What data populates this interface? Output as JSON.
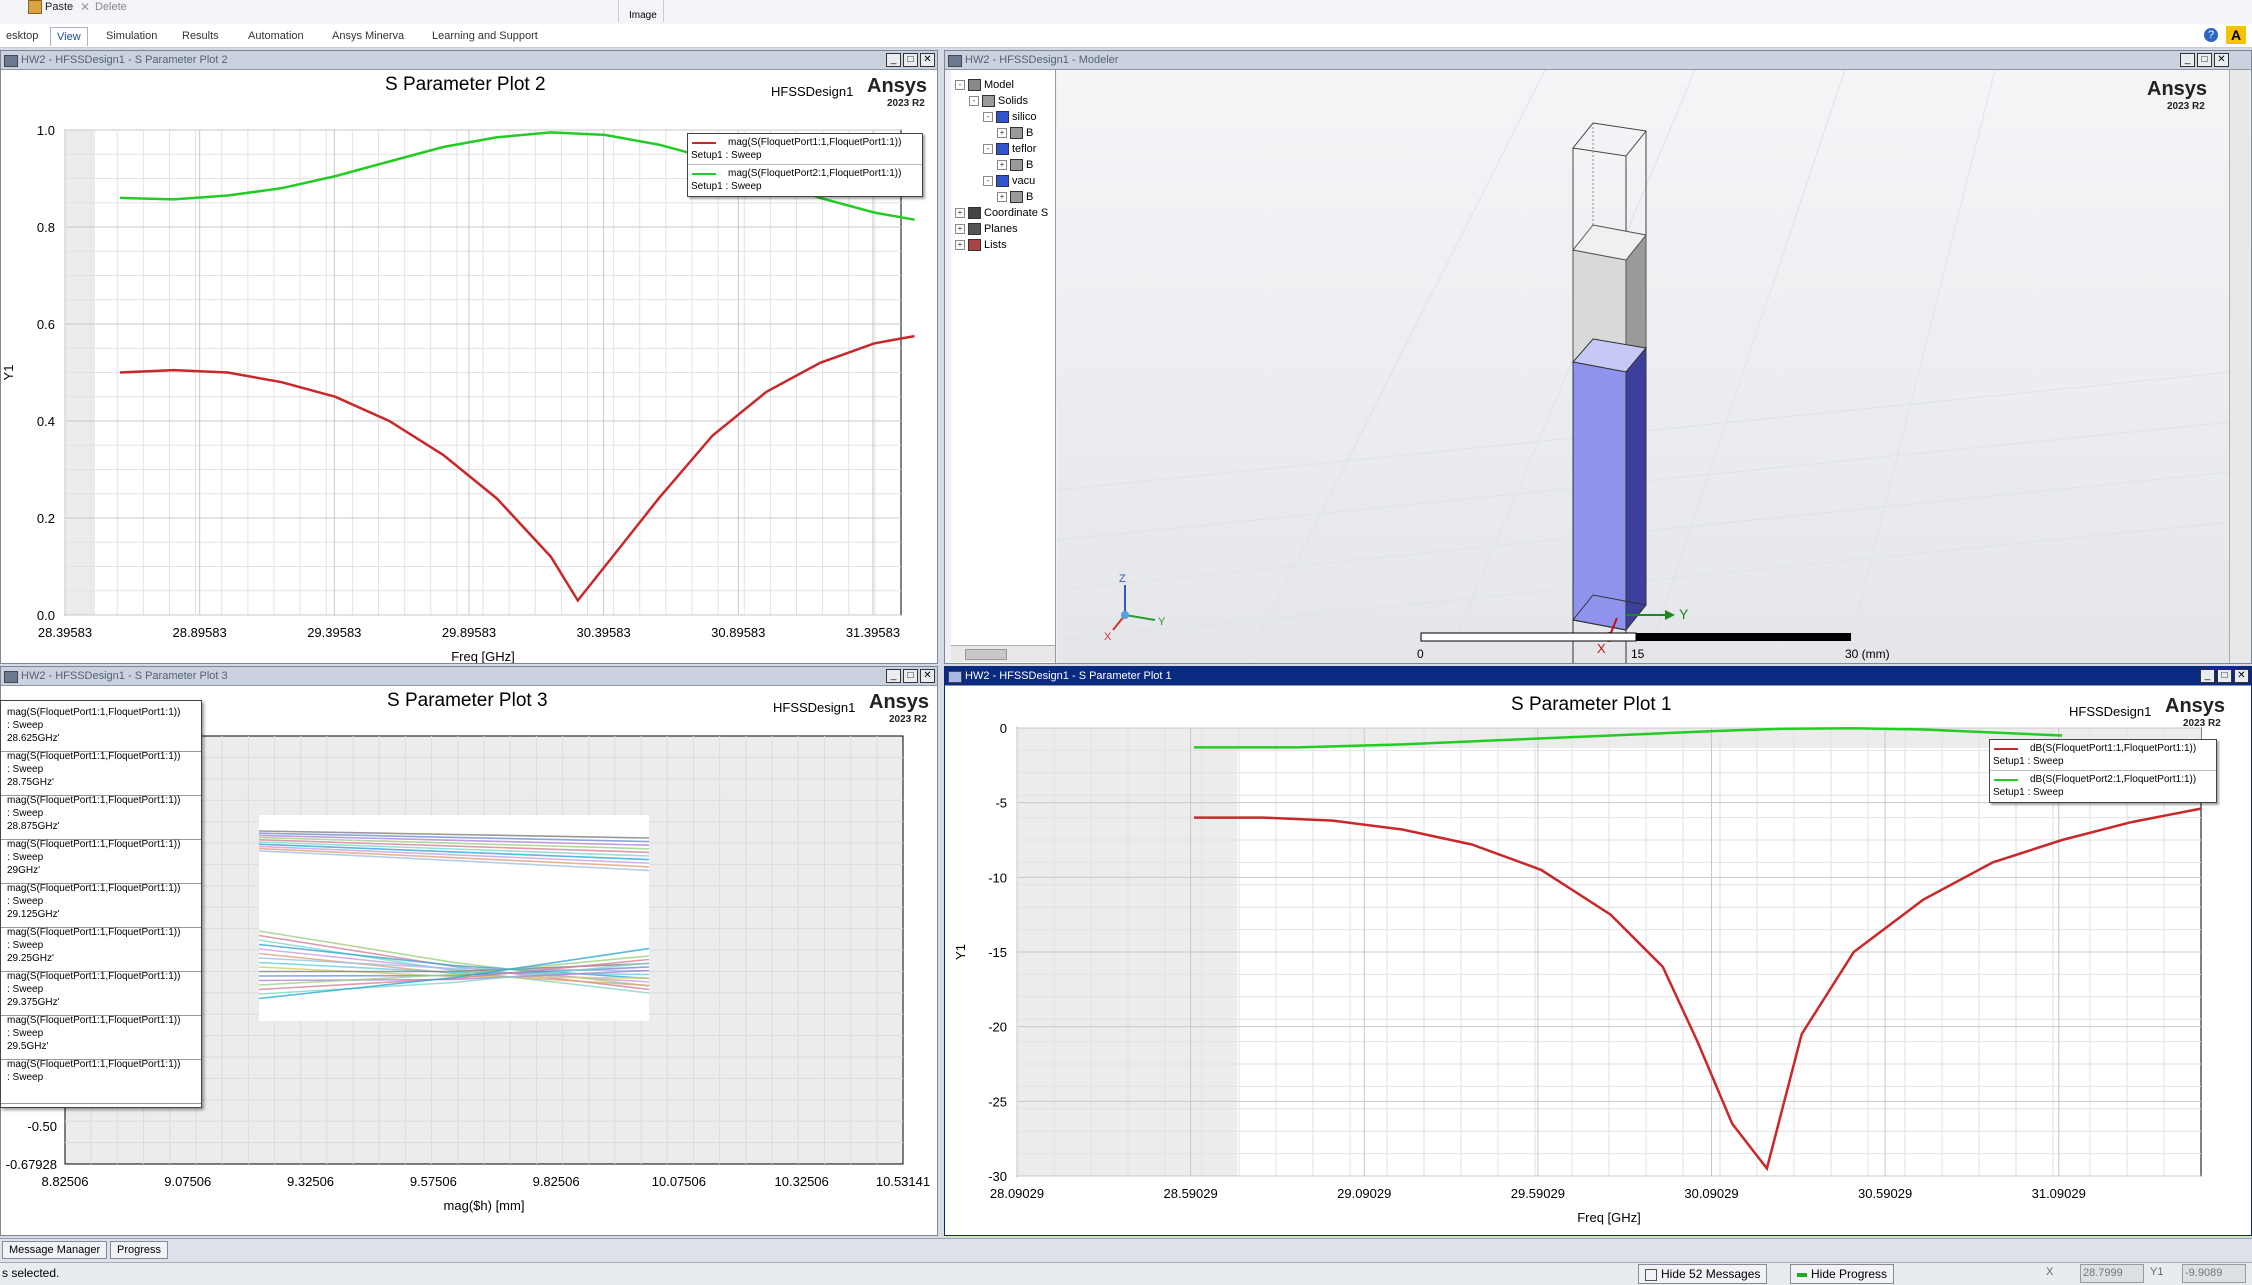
{
  "ribbon": {
    "paste_label": "Paste",
    "delete_label": "Delete",
    "capture_label": "Image",
    "tabs": [
      {
        "label": "esktop"
      },
      {
        "label": "View"
      },
      {
        "label": "Simulation"
      },
      {
        "label": "Results"
      },
      {
        "label": "Automation"
      },
      {
        "label": "Ansys Minerva"
      },
      {
        "label": "Learning and Support"
      }
    ],
    "active_tab": "View"
  },
  "windows": {
    "plot2": {
      "title": "HW2 - HFSSDesign1 - S Parameter Plot 2",
      "plot_title": "S Parameter Plot 2",
      "design": "HFSSDesign1",
      "brand": "Ansys",
      "version": "2023 R2",
      "legend": [
        {
          "name": "mag(S(FloquetPort1:1,FloquetPort1:1))",
          "setup": "Setup1 : Sweep",
          "color": "#c8282a"
        },
        {
          "name": "mag(S(FloquetPort2:1,FloquetPort1:1))",
          "setup": "Setup1 : Sweep",
          "color": "#22cc22"
        }
      ]
    },
    "modeler": {
      "title": "HW2 - HFSSDesign1 - Modeler",
      "brand": "Ansys",
      "version": "2023 R2",
      "scale_ticks": [
        "0",
        "15",
        "30 (mm)"
      ],
      "tree": [
        {
          "label": "Model",
          "level": 0,
          "box": "-"
        },
        {
          "label": "Solids",
          "level": 1,
          "box": "-"
        },
        {
          "label": "silico",
          "level": 2,
          "box": "-"
        },
        {
          "label": "B",
          "level": 3,
          "box": "+"
        },
        {
          "label": "teflor",
          "level": 2,
          "box": "-"
        },
        {
          "label": "B",
          "level": 3,
          "box": "+"
        },
        {
          "label": "vacu",
          "level": 2,
          "box": "-"
        },
        {
          "label": "B",
          "level": 3,
          "box": "+"
        },
        {
          "label": "Coordinate S",
          "level": 0,
          "box": "+"
        },
        {
          "label": "Planes",
          "level": 0,
          "box": "+"
        },
        {
          "label": "Lists",
          "level": 0,
          "box": "+"
        }
      ],
      "axis_labels": {
        "x": "X",
        "y": "Y",
        "z": "Z"
      }
    },
    "plot3": {
      "title": "HW2 - HFSSDesign1 - S Parameter Plot 3",
      "plot_title": "S Parameter Plot 3",
      "design": "HFSSDesign1",
      "brand": "Ansys",
      "version": "2023 R2",
      "legend": [
        {
          "name": "mag(S(FloquetPort1:1,FloquetPort1:1))",
          "setup": ": Sweep",
          "freq": "28.625GHz'"
        },
        {
          "name": "mag(S(FloquetPort1:1,FloquetPort1:1))",
          "setup": ": Sweep",
          "freq": "28.75GHz'"
        },
        {
          "name": "mag(S(FloquetPort1:1,FloquetPort1:1))",
          "setup": ": Sweep",
          "freq": "28.875GHz'"
        },
        {
          "name": "mag(S(FloquetPort1:1,FloquetPort1:1))",
          "setup": ": Sweep",
          "freq": "29GHz'"
        },
        {
          "name": "mag(S(FloquetPort1:1,FloquetPort1:1))",
          "setup": ": Sweep",
          "freq": "29.125GHz'"
        },
        {
          "name": "mag(S(FloquetPort1:1,FloquetPort1:1))",
          "setup": ": Sweep",
          "freq": "29.25GHz'"
        },
        {
          "name": "mag(S(FloquetPort1:1,FloquetPort1:1))",
          "setup": ": Sweep",
          "freq": "29.375GHz'"
        },
        {
          "name": "mag(S(FloquetPort1:1,FloquetPort1:1))",
          "setup": ": Sweep",
          "freq": "29.5GHz'"
        },
        {
          "name": "mag(S(FloquetPort1:1,FloquetPort1:1))",
          "setup": ": Sweep",
          "freq": ""
        }
      ]
    },
    "plot1": {
      "title": "HW2 - HFSSDesign1 - S Parameter Plot 1",
      "plot_title": "S Parameter Plot 1",
      "design": "HFSSDesign1",
      "brand": "Ansys",
      "version": "2023 R2",
      "legend": [
        {
          "name": "dB(S(FloquetPort1:1,FloquetPort1:1))",
          "setup": "Setup1 : Sweep",
          "color": "#c8282a"
        },
        {
          "name": "dB(S(FloquetPort2:1,FloquetPort1:1))",
          "setup": "Setup1 : Sweep",
          "color": "#22cc22"
        }
      ]
    }
  },
  "chart_data": [
    {
      "id": "plot2",
      "type": "line",
      "title": "S Parameter Plot 2",
      "xlabel": "Freq [GHz]",
      "ylabel": "Y1",
      "xlim": [
        28.39583,
        31.5
      ],
      "ylim": [
        0.0,
        1.0
      ],
      "xticks": [
        "28.39583",
        "28.89583",
        "29.39583",
        "29.89583",
        "30.39583",
        "30.89583",
        "31.39583"
      ],
      "yticks": [
        "0.0",
        "0.2",
        "0.4",
        "0.6",
        "0.8",
        "1.0"
      ],
      "series": [
        {
          "name": "mag(S(FloquetPort1:1,FloquetPort1:1))",
          "color": "#c8282a",
          "x": [
            28.6,
            28.8,
            29.0,
            29.2,
            29.4,
            29.6,
            29.8,
            30.0,
            30.2,
            30.3,
            30.4,
            30.6,
            30.8,
            31.0,
            31.2,
            31.4,
            31.55
          ],
          "y": [
            0.5,
            0.505,
            0.5,
            0.48,
            0.45,
            0.4,
            0.33,
            0.24,
            0.12,
            0.03,
            0.1,
            0.24,
            0.37,
            0.46,
            0.52,
            0.56,
            0.575
          ]
        },
        {
          "name": "mag(S(FloquetPort2:1,FloquetPort1:1))",
          "color": "#22cc22",
          "x": [
            28.6,
            28.8,
            29.0,
            29.2,
            29.4,
            29.6,
            29.8,
            30.0,
            30.2,
            30.4,
            30.6,
            30.8,
            31.0,
            31.2,
            31.4,
            31.55
          ],
          "y": [
            0.86,
            0.857,
            0.865,
            0.88,
            0.905,
            0.935,
            0.965,
            0.985,
            0.995,
            0.99,
            0.97,
            0.94,
            0.9,
            0.86,
            0.83,
            0.815
          ]
        }
      ]
    },
    {
      "id": "plot1",
      "type": "line",
      "title": "S Parameter Plot 1",
      "xlabel": "Freq [GHz]",
      "ylabel": "Y1",
      "xlim": [
        28.09029,
        31.5
      ],
      "ylim": [
        -30,
        0
      ],
      "xticks": [
        "28.09029",
        "28.59029",
        "29.09029",
        "29.59029",
        "30.09029",
        "30.59029",
        "31.09029"
      ],
      "yticks": [
        "0",
        "-5",
        "-10",
        "-15",
        "-20",
        "-25",
        "-30"
      ],
      "series": [
        {
          "name": "dB(S(FloquetPort1:1,FloquetPort1:1))",
          "color": "#c8282a",
          "x": [
            28.6,
            28.8,
            29.0,
            29.2,
            29.4,
            29.6,
            29.8,
            29.95,
            30.05,
            30.15,
            30.25,
            30.35,
            30.5,
            30.7,
            30.9,
            31.1,
            31.3,
            31.5
          ],
          "y": [
            -6.0,
            -6.0,
            -6.2,
            -6.8,
            -7.8,
            -9.5,
            -12.5,
            -16.0,
            -21.0,
            -26.5,
            -29.5,
            -20.5,
            -15.0,
            -11.5,
            -9.0,
            -7.5,
            -6.3,
            -5.4
          ]
        },
        {
          "name": "dB(S(FloquetPort2:1,FloquetPort1:1))",
          "color": "#22cc22",
          "x": [
            28.6,
            28.9,
            29.2,
            29.5,
            29.8,
            30.1,
            30.3,
            30.5,
            30.7,
            30.9,
            31.1
          ],
          "y": [
            -1.3,
            -1.3,
            -1.1,
            -0.8,
            -0.5,
            -0.2,
            -0.05,
            -0.02,
            -0.1,
            -0.3,
            -0.5
          ]
        }
      ]
    },
    {
      "id": "plot3",
      "type": "line",
      "title": "S Parameter Plot 3",
      "xlabel": "mag($h) [mm]",
      "ylabel": "",
      "xlim": [
        8.82506,
        10.53141
      ],
      "ylim": [
        -0.67928,
        1.0
      ],
      "xticks": [
        "8.82506",
        "9.07506",
        "9.32506",
        "9.57506",
        "9.82506",
        "10.07506",
        "10.32506",
        "10.53141"
      ],
      "yticks": [
        "-0.50",
        "-0.67928"
      ]
    }
  ],
  "status": {
    "tab_messages": "Message Manager",
    "tab_progress": "Progress",
    "left_text": "s selected.",
    "hide_messages": "Hide 52 Messages",
    "hide_progress": "Hide Progress",
    "x_label": "X",
    "x_value": "28.7999",
    "y_label": "Y1",
    "y_value": "-9.9089"
  }
}
